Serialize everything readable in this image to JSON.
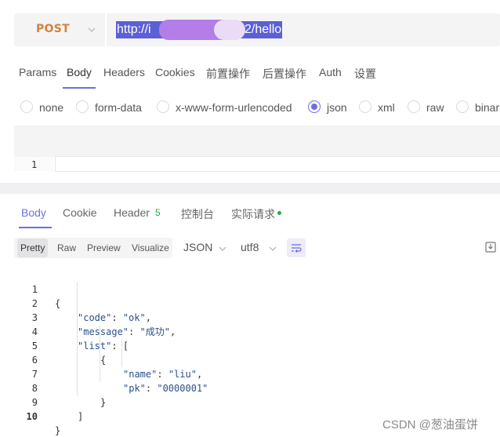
{
  "request": {
    "method": "POST",
    "url_prefix": "http://i",
    "url_suffix": "2/hello"
  },
  "request_tabs": [
    "Params",
    "Body",
    "Headers",
    "Cookies",
    "前置操作",
    "后置操作",
    "Auth",
    "设置"
  ],
  "request_tabs_active": "Body",
  "body_types": [
    {
      "label": "none",
      "checked": false
    },
    {
      "label": "form-data",
      "checked": false
    },
    {
      "label": "x-www-form-urlencoded",
      "checked": false
    },
    {
      "label": "json",
      "checked": true
    },
    {
      "label": "xml",
      "checked": false
    },
    {
      "label": "raw",
      "checked": false
    },
    {
      "label": "binar",
      "checked": false
    }
  ],
  "body_editor": {
    "line_number": "1"
  },
  "response_tabs": {
    "body": "Body",
    "cookie": "Cookie",
    "header": "Header",
    "header_count": "5",
    "console": "控制台",
    "actual_request": "实际请求"
  },
  "view_modes": [
    "Pretty",
    "Raw",
    "Preview",
    "Visualize"
  ],
  "view_mode_active": "Pretty",
  "format": "JSON",
  "encoding": "utf8",
  "response_code": {
    "line_numbers": [
      "1",
      "2",
      "3",
      "4",
      "5",
      "6",
      "7",
      "8",
      "9",
      "10"
    ],
    "open_brace": "{",
    "code_key": "\"code\"",
    "code_value": "\"ok\"",
    "message_key": "\"message\"",
    "message_value": "\"成功\"",
    "list_key": "\"list\"",
    "open_bracket": "[",
    "obj_open": "{",
    "name_key": "\"name\"",
    "name_value": "\"liu\"",
    "pk_key": "\"pk\"",
    "pk_value": "\"0000001\"",
    "obj_close": "}",
    "close_bracket": "]",
    "close_brace": "}",
    "colon": ": ",
    "comma": ","
  },
  "watermark": "CSDN @葱油蛋饼",
  "colors": {
    "accent": "#6c6ee0",
    "method": "#d4833a",
    "badge_green": "#28a745",
    "selection": "#5b60d6"
  }
}
